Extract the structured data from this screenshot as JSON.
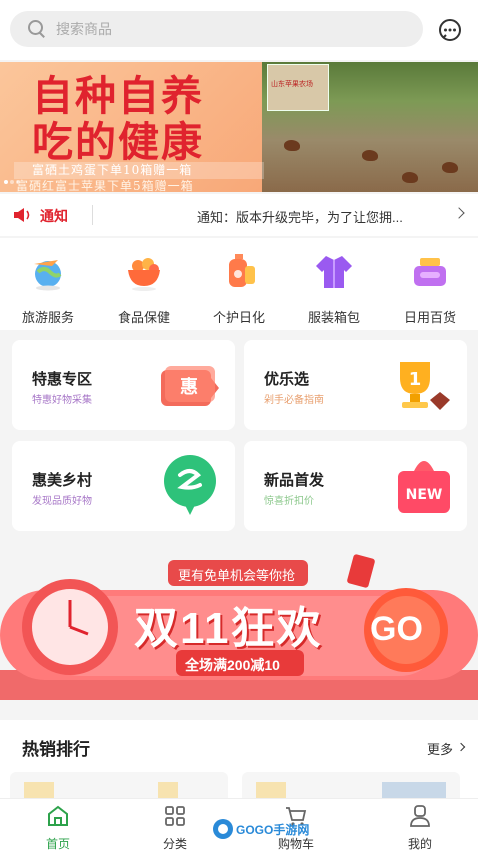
{
  "search": {
    "placeholder": "搜索商品"
  },
  "header": {
    "message_icon": "chat-bubble-icon"
  },
  "banner": {
    "title_line1": "自种自养",
    "title_line2": "吃的健康",
    "subtitle_line1": "富硒土鸡蛋下单10箱赠一箱",
    "subtitle_line2": "富硒红富士苹果下单5箱赠一箱",
    "inset_label": "山东苹果农场",
    "slide_count": 3,
    "active_slide": 1
  },
  "notice": {
    "label": "通知",
    "text": "通知：版本升级完毕，为了让您拥..."
  },
  "categories": [
    {
      "label": "旅游服务",
      "icon": "travel-globe-icon"
    },
    {
      "label": "食品保健",
      "icon": "food-bowl-icon"
    },
    {
      "label": "个护日化",
      "icon": "personal-care-bottle-icon"
    },
    {
      "label": "服装箱包",
      "icon": "clothing-jacket-icon"
    },
    {
      "label": "日用百货",
      "icon": "daily-goods-basket-icon"
    }
  ],
  "promos": [
    {
      "title": "特惠专区",
      "subtitle": "特惠好物采集",
      "icon": "discount-tag-icon",
      "tag_text": "惠"
    },
    {
      "title": "优乐选",
      "subtitle": "剁手必备指南",
      "icon": "trophy-icon",
      "tag_text": "1"
    },
    {
      "title": "惠美乡村",
      "subtitle": "发现品质好物",
      "icon": "village-badge-icon",
      "tag_text": ""
    },
    {
      "title": "新品首发",
      "subtitle": "惊喜折扣价",
      "icon": "new-gift-box-icon",
      "tag_text": "NEW"
    }
  ],
  "sale": {
    "top_text": "更有免单机会等你抢",
    "title": "双11狂欢",
    "deal": "全场满200减10",
    "go": "GO"
  },
  "hot": {
    "title": "热销排行",
    "more": "更多"
  },
  "tabs": [
    {
      "label": "首页",
      "icon": "home-icon",
      "active": true
    },
    {
      "label": "分类",
      "icon": "category-grid-icon",
      "active": false
    },
    {
      "label": "购物车",
      "icon": "cart-icon",
      "active": false
    },
    {
      "label": "我的",
      "icon": "user-icon",
      "active": false
    }
  ],
  "watermark": {
    "text": "GOGO手游网"
  },
  "colors": {
    "accent": "#2da24b",
    "brand_red": "#e0232e",
    "background": "#f4f4f4"
  }
}
